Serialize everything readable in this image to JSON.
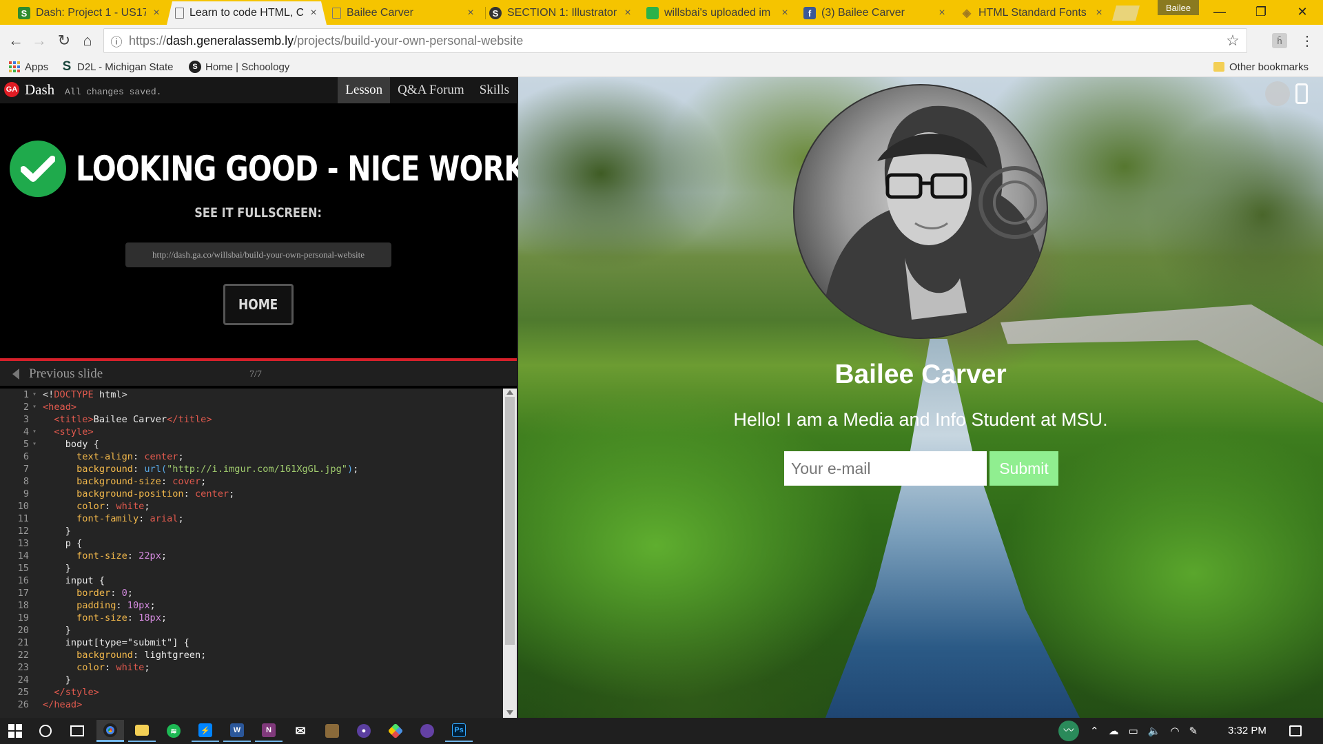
{
  "browser": {
    "tabs": [
      {
        "title": "Dash: Project 1 - US17",
        "favicon": "schoology-s",
        "color": "#2e8b2e"
      },
      {
        "title": "Learn to code HTML, C",
        "favicon": "page-icon",
        "color": "#777777"
      },
      {
        "title": "Bailee Carver",
        "favicon": "page-icon",
        "color": "#777777"
      },
      {
        "title": "SECTION 1: Illustrator |",
        "favicon": "schoology-s",
        "color": "#333333"
      },
      {
        "title": "willsbai's uploaded im",
        "favicon": "imgur-icon",
        "color": "#2cb24a"
      },
      {
        "title": "(3) Bailee Carver",
        "favicon": "facebook-icon",
        "color": "#3b5998"
      },
      {
        "title": "HTML Standard Fonts",
        "favicon": "diamond-icon",
        "color": "#a07a20"
      }
    ],
    "profile_name": "Bailee",
    "url": {
      "scheme": "https://",
      "host": "dash.generalassemb.ly",
      "path": "/projects/build-your-own-personal-website"
    },
    "bookmarks": [
      {
        "label": "Apps",
        "icon": "apps-grid-icon"
      },
      {
        "label": "D2L - Michigan State",
        "icon": "msu-s-icon"
      },
      {
        "label": "Home | Schoology",
        "icon": "schoology-icon"
      }
    ],
    "other_bookmarks": "Other bookmarks"
  },
  "dash": {
    "logo_text": "GA",
    "app_name": "Dash",
    "save_status": "All changes saved.",
    "nav": [
      "Lesson",
      "Q&A Forum",
      "Skills"
    ],
    "active_nav": "Lesson",
    "success_headline": "LOOKING GOOD - NICE WORK!",
    "fullscreen_label": "SEE IT FULLSCREEN:",
    "share_url": "http://dash.ga.co/willsbai/build-your-own-personal-website",
    "home_button": "HOME",
    "prev_slide": "Previous slide",
    "slide_counter": "7/7",
    "code": [
      {
        "n": "1",
        "fold": true,
        "parts": [
          [
            "c-punc",
            "<!"
          ],
          [
            "c-tag",
            "DOCTYPE"
          ],
          [
            "c-kw",
            " html"
          ],
          [
            "c-punc",
            ">"
          ]
        ]
      },
      {
        "n": "2",
        "fold": true,
        "parts": [
          [
            "c-tag",
            "<head>"
          ]
        ]
      },
      {
        "n": "3",
        "fold": false,
        "parts": [
          [
            "c-tag",
            "  <title>"
          ],
          [
            "c-kw",
            "Bailee Carver"
          ],
          [
            "c-tag",
            "</title>"
          ]
        ]
      },
      {
        "n": "4",
        "fold": true,
        "parts": [
          [
            "c-tag",
            "  <style>"
          ]
        ]
      },
      {
        "n": "5",
        "fold": true,
        "parts": [
          [
            "c-kw",
            "    body {"
          ]
        ]
      },
      {
        "n": "6",
        "fold": false,
        "parts": [
          [
            "c-prop",
            "      text-align"
          ],
          [
            "c-kw",
            ": "
          ],
          [
            "c-val",
            "center"
          ],
          [
            "c-kw",
            ";"
          ]
        ]
      },
      {
        "n": "7",
        "fold": false,
        "parts": [
          [
            "c-prop",
            "      background"
          ],
          [
            "c-kw",
            ": "
          ],
          [
            "c-fn",
            "url("
          ],
          [
            "c-str",
            "\"http://i.imgur.com/161XgGL.jpg\""
          ],
          [
            "c-fn",
            ")"
          ],
          [
            "c-kw",
            ";"
          ]
        ]
      },
      {
        "n": "8",
        "fold": false,
        "parts": [
          [
            "c-prop",
            "      background-size"
          ],
          [
            "c-kw",
            ": "
          ],
          [
            "c-val",
            "cover"
          ],
          [
            "c-kw",
            ";"
          ]
        ]
      },
      {
        "n": "9",
        "fold": false,
        "parts": [
          [
            "c-prop",
            "      background-position"
          ],
          [
            "c-kw",
            ": "
          ],
          [
            "c-val",
            "center"
          ],
          [
            "c-kw",
            ";"
          ]
        ]
      },
      {
        "n": "10",
        "fold": false,
        "parts": [
          [
            "c-prop",
            "      color"
          ],
          [
            "c-kw",
            ": "
          ],
          [
            "c-val",
            "white"
          ],
          [
            "c-kw",
            ";"
          ]
        ]
      },
      {
        "n": "11",
        "fold": false,
        "parts": [
          [
            "c-prop",
            "      font-family"
          ],
          [
            "c-kw",
            ": "
          ],
          [
            "c-val",
            "arial"
          ],
          [
            "c-kw",
            ";"
          ]
        ]
      },
      {
        "n": "12",
        "fold": false,
        "parts": [
          [
            "c-kw",
            "    }"
          ]
        ]
      },
      {
        "n": "13",
        "fold": false,
        "parts": [
          [
            "c-kw",
            "    p {"
          ]
        ]
      },
      {
        "n": "14",
        "fold": false,
        "parts": [
          [
            "c-prop",
            "      font-size"
          ],
          [
            "c-kw",
            ": "
          ],
          [
            "c-num",
            "22px"
          ],
          [
            "c-kw",
            ";"
          ]
        ]
      },
      {
        "n": "15",
        "fold": false,
        "parts": [
          [
            "c-kw",
            "    }"
          ]
        ]
      },
      {
        "n": "16",
        "fold": false,
        "parts": [
          [
            "c-kw",
            "    input {"
          ]
        ]
      },
      {
        "n": "17",
        "fold": false,
        "parts": [
          [
            "c-prop",
            "      border"
          ],
          [
            "c-kw",
            ": "
          ],
          [
            "c-num",
            "0"
          ],
          [
            "c-kw",
            ";"
          ]
        ]
      },
      {
        "n": "18",
        "fold": false,
        "parts": [
          [
            "c-prop",
            "      padding"
          ],
          [
            "c-kw",
            ": "
          ],
          [
            "c-num",
            "10px"
          ],
          [
            "c-kw",
            ";"
          ]
        ]
      },
      {
        "n": "19",
        "fold": false,
        "parts": [
          [
            "c-prop",
            "      font-size"
          ],
          [
            "c-kw",
            ": "
          ],
          [
            "c-num",
            "18px"
          ],
          [
            "c-kw",
            ";"
          ]
        ]
      },
      {
        "n": "20",
        "fold": false,
        "parts": [
          [
            "c-kw",
            "    }"
          ]
        ]
      },
      {
        "n": "21",
        "fold": false,
        "parts": [
          [
            "c-kw",
            "    input[type=\"submit\"] {"
          ]
        ]
      },
      {
        "n": "22",
        "fold": false,
        "parts": [
          [
            "c-prop",
            "      background"
          ],
          [
            "c-kw",
            ": lightgreen;"
          ]
        ]
      },
      {
        "n": "23",
        "fold": false,
        "parts": [
          [
            "c-prop",
            "      color"
          ],
          [
            "c-kw",
            ": "
          ],
          [
            "c-val",
            "white"
          ],
          [
            "c-kw",
            ";"
          ]
        ]
      },
      {
        "n": "24",
        "fold": false,
        "parts": [
          [
            "c-kw",
            "    }"
          ]
        ]
      },
      {
        "n": "25",
        "fold": false,
        "parts": [
          [
            "c-tag",
            "  </style>"
          ]
        ]
      },
      {
        "n": "26",
        "fold": false,
        "parts": [
          [
            "c-tag",
            "</head>"
          ]
        ]
      }
    ]
  },
  "preview": {
    "name": "Bailee Carver",
    "tagline": "Hello! I am a Media and Info Student at MSU.",
    "email_placeholder": "Your e-mail",
    "submit_label": "Submit"
  },
  "taskbar": {
    "apps": [
      {
        "name": "chrome",
        "active": true
      },
      {
        "name": "file-explorer",
        "active": false
      },
      {
        "name": "spotify",
        "active": false
      },
      {
        "name": "messenger",
        "active": false
      },
      {
        "name": "word",
        "active": false
      },
      {
        "name": "onenote",
        "active": false
      },
      {
        "name": "mail",
        "active": false
      },
      {
        "name": "media-app",
        "active": false
      },
      {
        "name": "purple-app",
        "active": false
      },
      {
        "name": "git-app",
        "active": false
      },
      {
        "name": "twitch",
        "active": false
      },
      {
        "name": "photoshop",
        "active": false
      }
    ],
    "time": "3:32 PM"
  },
  "colors": {
    "tabstrip": "#f5c400",
    "dash_red": "#d6202a",
    "success_green": "#1faa4c",
    "submit_green": "#90ee90"
  }
}
